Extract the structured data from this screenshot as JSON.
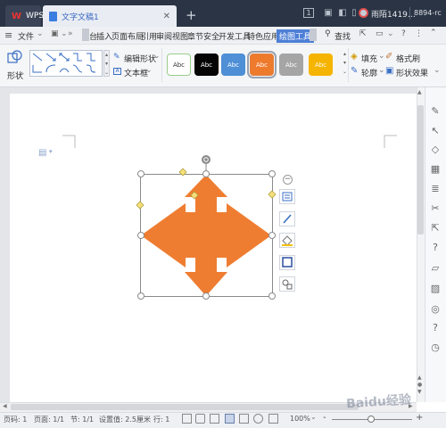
{
  "titlebar": {
    "app_tab": "WPS",
    "doc_tab": "文字文稿1",
    "badge": "1",
    "user_name": "雨陌1419…",
    "user_id": "8894-rc"
  },
  "menu": {
    "file": "文件",
    "more": "»",
    "items": [
      "台",
      "插入",
      "页面布局",
      "引用",
      "审阅",
      "视图",
      "章节",
      "安全",
      "开发工具",
      "特色应用",
      "绘图工具"
    ],
    "search": "查找"
  },
  "ribbon": {
    "shape_label": "形状",
    "edit_shape": "编辑形状",
    "textbox": "文本框",
    "styles": [
      {
        "label": "Abc",
        "bg": "#ffffff",
        "fg": "#333333",
        "border": "#9acd8a"
      },
      {
        "label": "Abc",
        "bg": "#050505",
        "fg": "#ffffff",
        "border": "#050505"
      },
      {
        "label": "Abc",
        "bg": "#4e8fd6",
        "fg": "#ffffff",
        "border": "#4e8fd6"
      },
      {
        "label": "Abc",
        "bg": "#ee7a2c",
        "fg": "#ffffff",
        "border": "#e08040"
      },
      {
        "label": "Abc",
        "bg": "#a5a5a5",
        "fg": "#ffffff",
        "border": "#a5a5a5"
      },
      {
        "label": "Abc",
        "bg": "#f5b400",
        "fg": "#ffffff",
        "border": "#f5b400"
      }
    ],
    "fill": "填充",
    "format_painter": "格式刷",
    "outline": "轮廓",
    "shape_effects": "形状效果"
  },
  "shape": {
    "fill_color": "#ef7d31",
    "type": "four-way-arrow"
  },
  "status": {
    "page": "页码: 1",
    "pages": "页面: 1/1",
    "section": "节: 1/1",
    "setting": "设置值: 2.5厘米",
    "row": "行: 1",
    "zoom": "100%",
    "zoom_minus": "-",
    "zoom_plus": "+"
  },
  "watermark": "Baidu经验"
}
